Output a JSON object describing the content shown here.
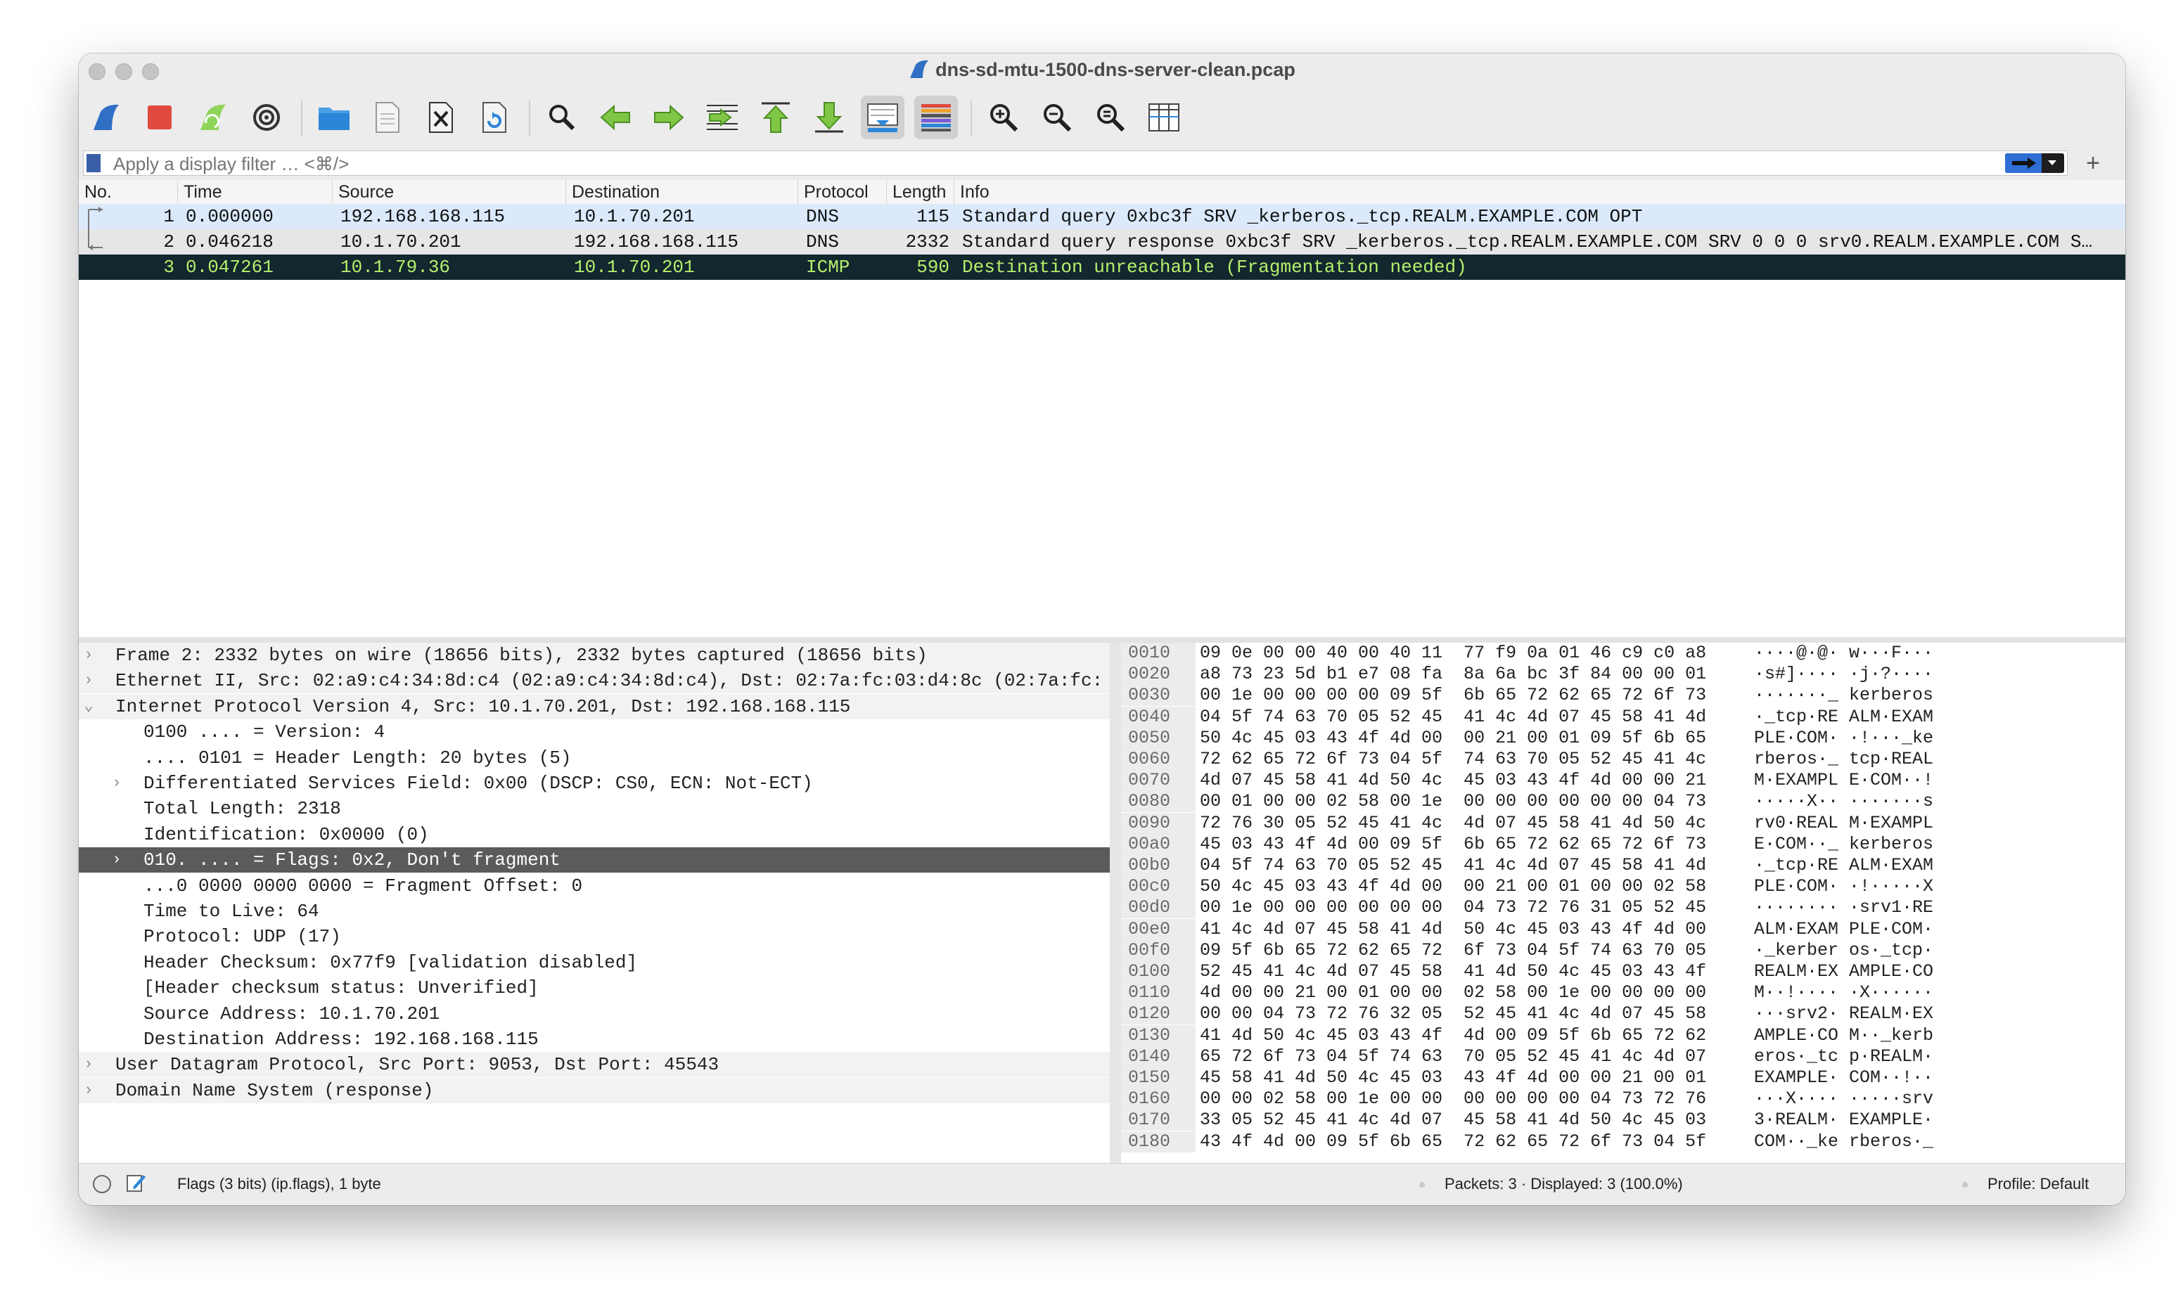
{
  "window": {
    "title": "dns-sd-mtu-1500-dns-server-clean.pcap",
    "traffic_lights": [
      "close-button",
      "minimize-button",
      "zoom-button"
    ]
  },
  "toolbar": {
    "buttons": [
      {
        "name": "start-capture-button",
        "icon": "shark-fin-icon"
      },
      {
        "name": "stop-capture-button",
        "icon": "stop-icon"
      },
      {
        "name": "restart-capture-button",
        "icon": "restart-fin-icon"
      },
      {
        "name": "capture-options-button",
        "icon": "gear-icon"
      },
      {
        "name": "open-file-button",
        "icon": "folder-icon"
      },
      {
        "name": "save-file-button",
        "icon": "document-icon"
      },
      {
        "name": "close-file-button",
        "icon": "close-file-icon"
      },
      {
        "name": "reload-file-button",
        "icon": "reload-icon"
      },
      {
        "name": "find-packet-button",
        "icon": "magnifier-icon"
      },
      {
        "name": "go-back-button",
        "icon": "arrow-left-icon"
      },
      {
        "name": "go-forward-button",
        "icon": "arrow-right-icon"
      },
      {
        "name": "go-to-packet-button",
        "icon": "go-to-packet-icon"
      },
      {
        "name": "go-first-packet-button",
        "icon": "arrow-up-icon"
      },
      {
        "name": "go-last-packet-button",
        "icon": "arrow-down-icon"
      },
      {
        "name": "autoscroll-button",
        "icon": "autoscroll-icon"
      },
      {
        "name": "colorize-button",
        "icon": "colorize-icon"
      },
      {
        "name": "zoom-in-button",
        "icon": "zoom-in-icon"
      },
      {
        "name": "zoom-out-button",
        "icon": "zoom-out-icon"
      },
      {
        "name": "normal-size-button",
        "icon": "zoom-reset-icon"
      },
      {
        "name": "resize-columns-button",
        "icon": "resize-columns-icon"
      }
    ]
  },
  "filter": {
    "placeholder": "Apply a display filter … <⌘/>",
    "add_label": "+"
  },
  "packet_list": {
    "columns": [
      "No.",
      "Time",
      "Source",
      "Destination",
      "Protocol",
      "Length",
      "Info"
    ],
    "rows": [
      {
        "no": "1",
        "time": "0.000000",
        "source": "192.168.168.115",
        "destination": "10.1.70.201",
        "protocol": "DNS",
        "length": "115",
        "info": "Standard query 0xbc3f SRV _kerberos._tcp.REALM.EXAMPLE.COM OPT"
      },
      {
        "no": "2",
        "time": "0.046218",
        "source": "10.1.70.201",
        "destination": "192.168.168.115",
        "protocol": "DNS",
        "length": "2332",
        "info": "Standard query response 0xbc3f SRV _kerberos._tcp.REALM.EXAMPLE.COM SRV 0 0 0 srv0.REALM.EXAMPLE.COM S…"
      },
      {
        "no": "3",
        "time": "0.047261",
        "source": "10.1.79.36",
        "destination": "10.1.70.201",
        "protocol": "ICMP",
        "length": "590",
        "info": "Destination unreachable (Fragmentation needed)"
      }
    ]
  },
  "details": {
    "rows": [
      {
        "text": "Frame 2: 2332 bytes on wire (18656 bits), 2332 bytes captured (18656 bits)",
        "level": 0,
        "arrow": ">"
      },
      {
        "text": "Ethernet II, Src: 02:a9:c4:34:8d:c4 (02:a9:c4:34:8d:c4), Dst: 02:7a:fc:03:d4:8c (02:7a:fc:",
        "level": 0,
        "arrow": ">"
      },
      {
        "text": "Internet Protocol Version 4, Src: 10.1.70.201, Dst: 192.168.168.115",
        "level": 0,
        "arrow": "v"
      },
      {
        "text": "0100 .... = Version: 4",
        "level": 1,
        "arrow": ""
      },
      {
        "text": ".... 0101 = Header Length: 20 bytes (5)",
        "level": 1,
        "arrow": ""
      },
      {
        "text": "Differentiated Services Field: 0x00 (DSCP: CS0, ECN: Not-ECT)",
        "level": 1,
        "arrow": ">"
      },
      {
        "text": "Total Length: 2318",
        "level": 1,
        "arrow": ""
      },
      {
        "text": "Identification: 0x0000 (0)",
        "level": 1,
        "arrow": ""
      },
      {
        "text": "010. .... = Flags: 0x2, Don't fragment",
        "level": 1,
        "arrow": ">",
        "selected": true
      },
      {
        "text": "...0 0000 0000 0000 = Fragment Offset: 0",
        "level": 1,
        "arrow": ""
      },
      {
        "text": "Time to Live: 64",
        "level": 1,
        "arrow": ""
      },
      {
        "text": "Protocol: UDP (17)",
        "level": 1,
        "arrow": ""
      },
      {
        "text": "Header Checksum: 0x77f9 [validation disabled]",
        "level": 1,
        "arrow": ""
      },
      {
        "text": "[Header checksum status: Unverified]",
        "level": 1,
        "arrow": ""
      },
      {
        "text": "Source Address: 10.1.70.201",
        "level": 1,
        "arrow": ""
      },
      {
        "text": "Destination Address: 192.168.168.115",
        "level": 1,
        "arrow": ""
      },
      {
        "text": "User Datagram Protocol, Src Port: 9053, Dst Port: 45543",
        "level": 0,
        "arrow": ">"
      },
      {
        "text": "Domain Name System (response)",
        "level": 0,
        "arrow": ">"
      }
    ]
  },
  "hex_dump": {
    "rows": [
      {
        "offset": "0010",
        "bytes": "09 0e 00 00 40 00 40 11  77 f9 0a 01 46 c9 c0 a8",
        "ascii": "····@·@· w···F···"
      },
      {
        "offset": "0020",
        "bytes": "a8 73 23 5d b1 e7 08 fa  8a 6a bc 3f 84 00 00 01",
        "ascii": "·s#]···· ·j·?····"
      },
      {
        "offset": "0030",
        "bytes": "00 1e 00 00 00 00 09 5f  6b 65 72 62 65 72 6f 73",
        "ascii": "·······_ kerberos"
      },
      {
        "offset": "0040",
        "bytes": "04 5f 74 63 70 05 52 45  41 4c 4d 07 45 58 41 4d",
        "ascii": "·_tcp·RE ALM·EXAM"
      },
      {
        "offset": "0050",
        "bytes": "50 4c 45 03 43 4f 4d 00  00 21 00 01 09 5f 6b 65",
        "ascii": "PLE·COM· ·!···_ke"
      },
      {
        "offset": "0060",
        "bytes": "72 62 65 72 6f 73 04 5f  74 63 70 05 52 45 41 4c",
        "ascii": "rberos·_ tcp·REAL"
      },
      {
        "offset": "0070",
        "bytes": "4d 07 45 58 41 4d 50 4c  45 03 43 4f 4d 00 00 21",
        "ascii": "M·EXAMPL E·COM··!"
      },
      {
        "offset": "0080",
        "bytes": "00 01 00 00 02 58 00 1e  00 00 00 00 00 00 04 73",
        "ascii": "·····X·· ·······s"
      },
      {
        "offset": "0090",
        "bytes": "72 76 30 05 52 45 41 4c  4d 07 45 58 41 4d 50 4c",
        "ascii": "rv0·REAL M·EXAMPL"
      },
      {
        "offset": "00a0",
        "bytes": "45 03 43 4f 4d 00 09 5f  6b 65 72 62 65 72 6f 73",
        "ascii": "E·COM··_ kerberos"
      },
      {
        "offset": "00b0",
        "bytes": "04 5f 74 63 70 05 52 45  41 4c 4d 07 45 58 41 4d",
        "ascii": "·_tcp·RE ALM·EXAM"
      },
      {
        "offset": "00c0",
        "bytes": "50 4c 45 03 43 4f 4d 00  00 21 00 01 00 00 02 58",
        "ascii": "PLE·COM· ·!·····X"
      },
      {
        "offset": "00d0",
        "bytes": "00 1e 00 00 00 00 00 00  04 73 72 76 31 05 52 45",
        "ascii": "········ ·srv1·RE"
      },
      {
        "offset": "00e0",
        "bytes": "41 4c 4d 07 45 58 41 4d  50 4c 45 03 43 4f 4d 00",
        "ascii": "ALM·EXAM PLE·COM·"
      },
      {
        "offset": "00f0",
        "bytes": "09 5f 6b 65 72 62 65 72  6f 73 04 5f 74 63 70 05",
        "ascii": "·_kerber os·_tcp·"
      },
      {
        "offset": "0100",
        "bytes": "52 45 41 4c 4d 07 45 58  41 4d 50 4c 45 03 43 4f",
        "ascii": "REALM·EX AMPLE·CO"
      },
      {
        "offset": "0110",
        "bytes": "4d 00 00 21 00 01 00 00  02 58 00 1e 00 00 00 00",
        "ascii": "M··!···· ·X······"
      },
      {
        "offset": "0120",
        "bytes": "00 00 04 73 72 76 32 05  52 45 41 4c 4d 07 45 58",
        "ascii": "···srv2· REALM·EX"
      },
      {
        "offset": "0130",
        "bytes": "41 4d 50 4c 45 03 43 4f  4d 00 09 5f 6b 65 72 62",
        "ascii": "AMPLE·CO M··_kerb"
      },
      {
        "offset": "0140",
        "bytes": "65 72 6f 73 04 5f 74 63  70 05 52 45 41 4c 4d 07",
        "ascii": "eros·_tc p·REALM·"
      },
      {
        "offset": "0150",
        "bytes": "45 58 41 4d 50 4c 45 03  43 4f 4d 00 00 21 00 01",
        "ascii": "EXAMPLE· COM··!··"
      },
      {
        "offset": "0160",
        "bytes": "00 00 02 58 00 1e 00 00  00 00 00 00 04 73 72 76",
        "ascii": "···X···· ·····srv"
      },
      {
        "offset": "0170",
        "bytes": "33 05 52 45 41 4c 4d 07  45 58 41 4d 50 4c 45 03",
        "ascii": "3·REALM· EXAMPLE·"
      },
      {
        "offset": "0180",
        "bytes": "43 4f 4d 00 09 5f 6b 65  72 62 65 72 6f 73 04 5f",
        "ascii": "COM··_ke rberos·_"
      }
    ]
  },
  "status": {
    "field_info": "Flags (3 bits) (ip.flags), 1 byte",
    "packets": "Packets: 3 · Displayed: 3 (100.0%)",
    "profile": "Profile: Default"
  },
  "colors": {
    "selected_detail_bg": "#5b5b5b",
    "icmp_row_bg": "#12272e",
    "icmp_row_fg": "#b4f06c",
    "dns_row_bg": "#dbe9fb",
    "accent_blue": "#2e6fd6"
  }
}
